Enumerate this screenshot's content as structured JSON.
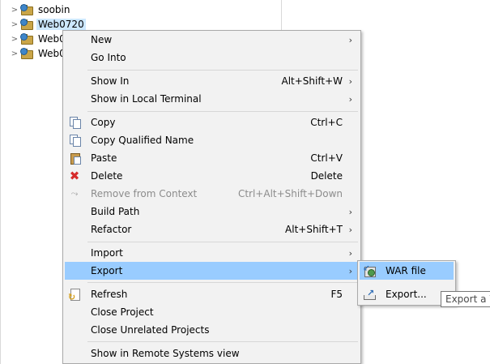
{
  "explorer": {
    "projects": [
      {
        "label": "soobin",
        "selected": false
      },
      {
        "label": "Web0720",
        "selected": true
      },
      {
        "label": "Web0",
        "selected": false
      },
      {
        "label": "Web0",
        "selected": false
      }
    ]
  },
  "context_menu": {
    "items": [
      {
        "label": "New",
        "accel": "",
        "submenu": true,
        "icon": "",
        "disabled": false
      },
      {
        "label": "Go Into",
        "accel": "",
        "submenu": false,
        "icon": "",
        "disabled": false
      },
      {
        "label": "Show In",
        "accel": "Alt+Shift+W",
        "submenu": true,
        "icon": "",
        "disabled": false
      },
      {
        "label": "Show in Local Terminal",
        "accel": "",
        "submenu": true,
        "icon": "",
        "disabled": false
      },
      {
        "label": "Copy",
        "accel": "Ctrl+C",
        "submenu": false,
        "icon": "copy-icon",
        "disabled": false
      },
      {
        "label": "Copy Qualified Name",
        "accel": "",
        "submenu": false,
        "icon": "copy-qualified-name-icon",
        "disabled": false
      },
      {
        "label": "Paste",
        "accel": "Ctrl+V",
        "submenu": false,
        "icon": "paste-icon",
        "disabled": false
      },
      {
        "label": "Delete",
        "accel": "Delete",
        "submenu": false,
        "icon": "delete-icon",
        "disabled": false
      },
      {
        "label": "Remove from Context",
        "accel": "Ctrl+Alt+Shift+Down",
        "submenu": false,
        "icon": "remove-context-icon",
        "disabled": true
      },
      {
        "label": "Build Path",
        "accel": "",
        "submenu": true,
        "icon": "",
        "disabled": false
      },
      {
        "label": "Refactor",
        "accel": "Alt+Shift+T",
        "submenu": true,
        "icon": "",
        "disabled": false
      },
      {
        "label": "Import",
        "accel": "",
        "submenu": true,
        "icon": "",
        "disabled": false
      },
      {
        "label": "Export",
        "accel": "",
        "submenu": true,
        "icon": "",
        "disabled": false,
        "highlighted": true
      },
      {
        "label": "Refresh",
        "accel": "F5",
        "submenu": false,
        "icon": "refresh-icon",
        "disabled": false
      },
      {
        "label": "Close Project",
        "accel": "",
        "submenu": false,
        "icon": "",
        "disabled": false
      },
      {
        "label": "Close Unrelated Projects",
        "accel": "",
        "submenu": false,
        "icon": "",
        "disabled": false
      },
      {
        "label": "Show in Remote Systems view",
        "accel": "",
        "submenu": false,
        "icon": "",
        "disabled": false
      }
    ],
    "arrow_glyph": "›"
  },
  "export_submenu": {
    "items": [
      {
        "label": "WAR file",
        "icon": "war-file-icon",
        "highlighted": true
      },
      {
        "label": "Export...",
        "icon": "export-icon",
        "highlighted": false
      }
    ]
  },
  "tooltip": {
    "text": "Export a W"
  },
  "colors": {
    "highlight": "#99ccff",
    "selection": "#cde8ff",
    "menu_background": "#f2f2f2"
  }
}
